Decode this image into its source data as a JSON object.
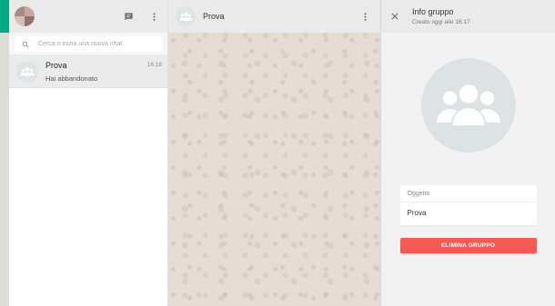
{
  "sidebar": {
    "search": {
      "placeholder": "Cerca o inizia una nuova chat"
    },
    "chats": [
      {
        "name": "Prova",
        "time": "16:18",
        "preview": "Hai abbandonato"
      }
    ]
  },
  "conversation": {
    "title": "Prova"
  },
  "info_panel": {
    "title": "Info gruppo",
    "subtitle": "Creato oggi alle 16:17",
    "subject_label": "Oggetto",
    "subject_value": "Prova",
    "delete_label": "ELIMINA GRUPPO"
  },
  "colors": {
    "accent": "#00a884",
    "danger": "#f45a54",
    "chat_background": "#e5ddd4"
  },
  "icons": [
    "search-icon",
    "new-chat-icon",
    "menu-icon",
    "group-icon",
    "close-icon"
  ]
}
